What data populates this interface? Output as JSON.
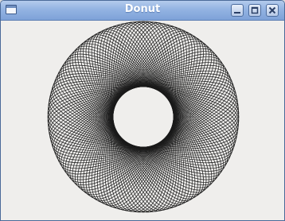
{
  "window": {
    "title": "Donut",
    "app_icon": "window-icon",
    "controls": [
      "minimize-icon",
      "maximize-icon",
      "close-icon"
    ]
  },
  "drawing": {
    "shape": "rotated-ellipses",
    "stroke_color": "#1a1a1a",
    "background": "#efeeec"
  }
}
